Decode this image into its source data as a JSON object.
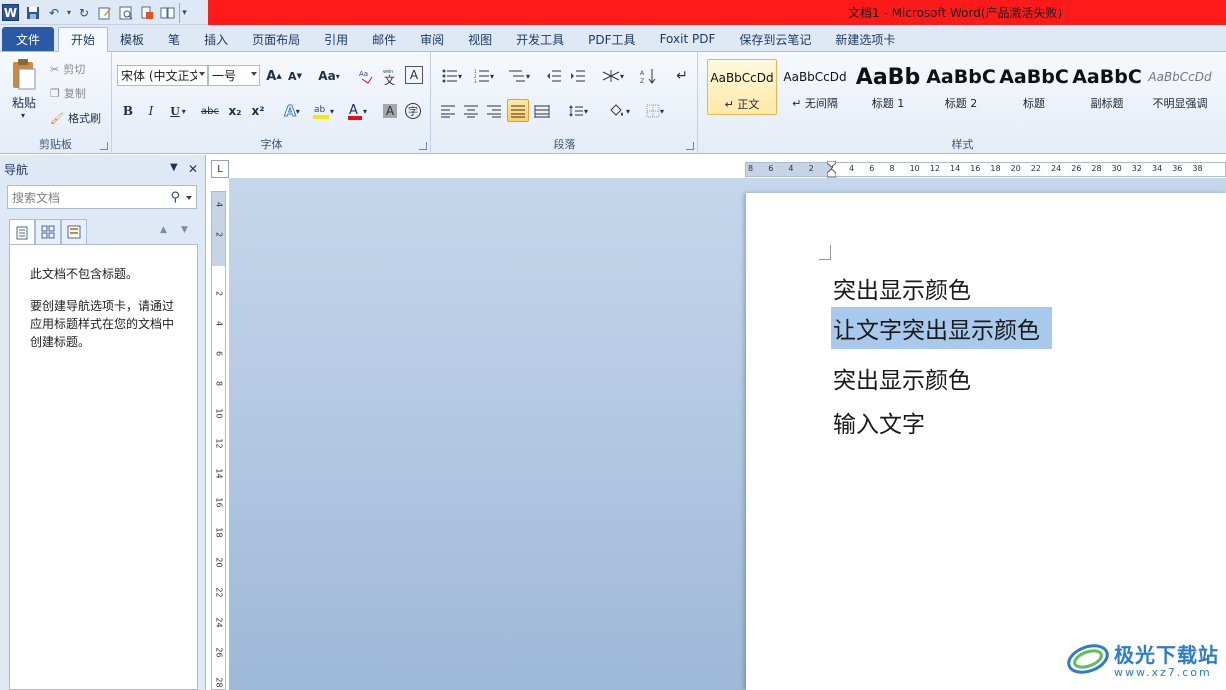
{
  "window": {
    "title": "文档1 - Microsoft Word(产品激活失败)",
    "app_icon_letter": "W"
  },
  "tabs": [
    "文件",
    "开始",
    "模板",
    "笔",
    "插入",
    "页面布局",
    "引用",
    "邮件",
    "审阅",
    "视图",
    "开发工具",
    "PDF工具",
    "Foxit PDF",
    "保存到云笔记",
    "新建选项卡"
  ],
  "active_tab": "开始",
  "ribbon": {
    "clipboard": {
      "label": "剪贴板",
      "paste": "粘贴",
      "cut": "剪切",
      "copy": "复制",
      "format_painter": "格式刷"
    },
    "font": {
      "label": "字体",
      "font_name": "宋体 (中文正文)",
      "font_size": "一号",
      "bold": "B",
      "italic": "I",
      "underline": "U",
      "strike": "abc",
      "subscript": "x₂",
      "superscript": "x²",
      "grow": "A",
      "shrink": "A",
      "change_case": "Aa",
      "font_color_accent": "#e0101c",
      "highlight_accent": "#f5e80a"
    },
    "paragraph": {
      "label": "段落"
    },
    "styles": {
      "label": "样式",
      "items": [
        {
          "sample": "AaBbCcDd",
          "name": "↵ 正文"
        },
        {
          "sample": "AaBbCcDd",
          "name": "↵ 无间隔"
        },
        {
          "sample": "AaBb",
          "name": "标题 1"
        },
        {
          "sample": "AaBbC",
          "name": "标题 2"
        },
        {
          "sample": "AaBbC",
          "name": "标题"
        },
        {
          "sample": "AaBbC",
          "name": "副标题"
        },
        {
          "sample": "AaBbCcDd",
          "name": "不明显强调"
        }
      ]
    }
  },
  "nav": {
    "title": "导航",
    "search_placeholder": "搜索文档",
    "message1": "此文档不包含标题。",
    "message2": "要创建导航选项卡，请通过应用标题样式在您的文档中创建标题。"
  },
  "ruler": {
    "h_ticks": [
      "8",
      "6",
      "4",
      "2",
      "2",
      "4",
      "6",
      "8",
      "10",
      "12",
      "14",
      "16",
      "18",
      "20",
      "22",
      "24",
      "26",
      "28",
      "30",
      "32",
      "34",
      "36",
      "38"
    ],
    "v_ticks": [
      "4",
      "2",
      "2",
      "4",
      "6",
      "8",
      "10",
      "12",
      "14",
      "16",
      "18",
      "20",
      "22",
      "24",
      "26",
      "28"
    ],
    "corner": "L"
  },
  "document": {
    "lines": [
      "突出显示颜色",
      "让文字突出显示颜色",
      "突出显示颜色",
      "输入文字"
    ],
    "highlight_color": "#a9c9ec"
  },
  "watermark": {
    "name": "极光下载站",
    "url": "www.xz7.com"
  }
}
